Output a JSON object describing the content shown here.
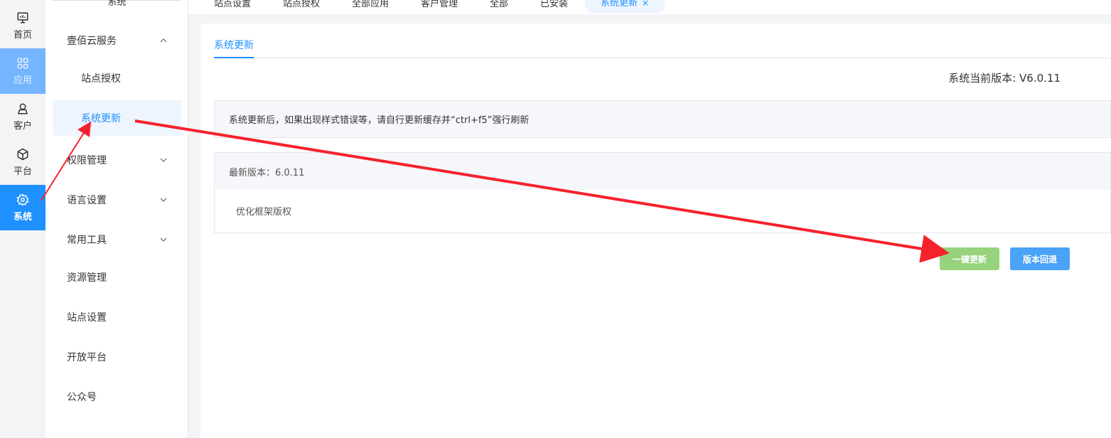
{
  "rail": {
    "items": [
      {
        "label": "首页",
        "icon": "monitor-icon"
      },
      {
        "label": "应用",
        "icon": "apps-grid-icon"
      },
      {
        "label": "客户",
        "icon": "user-icon"
      },
      {
        "label": "平台",
        "icon": "cube-icon"
      },
      {
        "label": "系统",
        "icon": "gear-icon"
      }
    ]
  },
  "menu": {
    "top_label": "系统",
    "items": [
      {
        "label": "壹佰云服务"
      },
      {
        "label": "站点授权"
      },
      {
        "label": "系统更新"
      },
      {
        "label": "权限管理"
      },
      {
        "label": "语言设置"
      },
      {
        "label": "常用工具"
      },
      {
        "label": "资源管理"
      },
      {
        "label": "站点设置"
      },
      {
        "label": "开放平台"
      },
      {
        "label": "公众号"
      }
    ]
  },
  "tabs": [
    {
      "label": "站点设置"
    },
    {
      "label": "站点授权"
    },
    {
      "label": "全部应用"
    },
    {
      "label": "客户管理"
    },
    {
      "label": "全部"
    },
    {
      "label": "已安装"
    },
    {
      "label": "系统更新",
      "close": "×"
    }
  ],
  "content": {
    "inner_tab": "系统更新",
    "current_version": "系统当前版本: V6.0.11",
    "notice": "系统更新后，如果出现样式错误等，请自行更新缓存并“ctrl+f5”强行刷新",
    "release_title": "最新版本：6.0.11",
    "release_note": "优化框架版权",
    "update_button": "一键更新",
    "rollback_button": "版本回退"
  },
  "colors": {
    "accent": "#1e90ff",
    "update_green": "#96d37c",
    "rollback_blue": "#4aa3f6",
    "annotation_red": "#f5222d"
  }
}
